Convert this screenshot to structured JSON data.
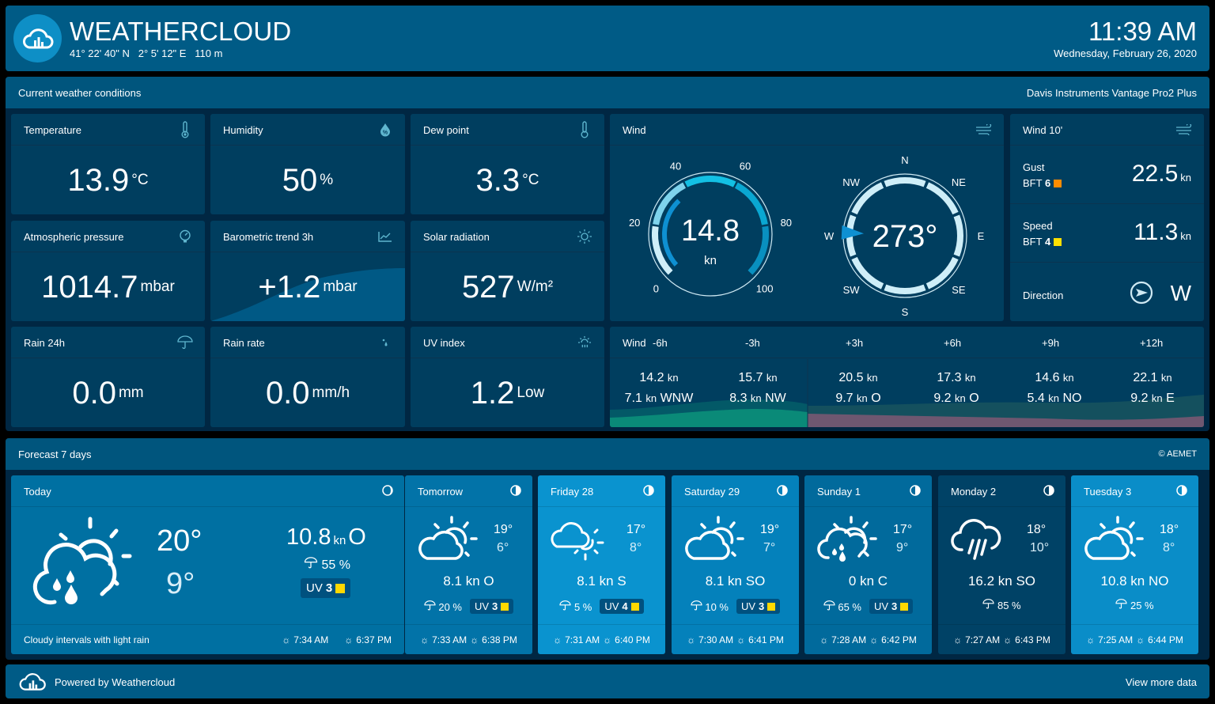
{
  "header": {
    "brand": "WEATHERCLOUD",
    "coords": "41° 22' 40\" N   2° 5' 12\" E   110 m",
    "time": "11:39 AM",
    "date": "Wednesday, February 26, 2020"
  },
  "current": {
    "title": "Current weather conditions",
    "device": "Davis Instruments Vantage Pro2 Plus",
    "temperature": {
      "label": "Temperature",
      "value": "13.9",
      "unit": "°C",
      "icon": "thermometer-icon"
    },
    "humidity": {
      "label": "Humidity",
      "value": "50",
      "unit": "%",
      "icon": "humidity-drop-icon"
    },
    "dewpoint": {
      "label": "Dew point",
      "value": "3.3",
      "unit": "°C",
      "icon": "thermometer-icon"
    },
    "pressure": {
      "label": "Atmospheric pressure",
      "value": "1014.7",
      "unit": "mbar",
      "icon": "barometer-icon"
    },
    "trend": {
      "label": "Barometric trend 3h",
      "value": "+1.2",
      "unit": "mbar",
      "icon": "trend-chart-icon"
    },
    "solar": {
      "label": "Solar radiation",
      "value": "527",
      "unit": "W/m²",
      "icon": "sun-icon"
    },
    "rain24": {
      "label": "Rain 24h",
      "value": "0.0",
      "unit": "mm",
      "icon": "umbrella-icon"
    },
    "rainrate": {
      "label": "Rain rate",
      "value": "0.0",
      "unit": "mm/h",
      "icon": "raindrops-icon"
    },
    "uv": {
      "label": "UV index",
      "value": "1.2",
      "unit": "Low",
      "icon": "uv-sun-icon"
    },
    "wind": {
      "label": "Wind",
      "speed": "14.8",
      "speed_value": 14.8,
      "speed_max": 100,
      "unit": "kn",
      "ticks": [
        "0",
        "20",
        "40",
        "60",
        "80",
        "100"
      ],
      "direction": "273°",
      "direction_deg": 273,
      "compass": [
        "N",
        "NE",
        "E",
        "SE",
        "S",
        "SW",
        "W",
        "NW"
      ]
    },
    "wind10": {
      "label": "Wind 10'",
      "gust_label": "Gust",
      "gust_bft": "BFT",
      "gust_bft_value": "6",
      "gust_color": "#ff8c00",
      "gust_value": "22.5",
      "speed_label": "Speed",
      "speed_bft": "BFT",
      "speed_bft_value": "4",
      "speed_color": "#ffe000",
      "speed_value": "11.3",
      "unit": "kn",
      "direction_label": "Direction",
      "direction_value": "W"
    },
    "wind_forecast": {
      "label": "Wind",
      "columns": [
        {
          "time": "-6h",
          "gust": "14.2",
          "mean": "7.1",
          "dir": "WNW"
        },
        {
          "time": "-3h",
          "gust": "15.7",
          "mean": "8.3",
          "dir": "NW"
        },
        {
          "time": "+3h",
          "gust": "20.5",
          "mean": "9.7",
          "dir": "O"
        },
        {
          "time": "+6h",
          "gust": "17.3",
          "mean": "9.2",
          "dir": "O"
        },
        {
          "time": "+9h",
          "gust": "14.6",
          "mean": "5.4",
          "dir": "NO"
        },
        {
          "time": "+12h",
          "gust": "22.1",
          "mean": "9.2",
          "dir": "E"
        }
      ],
      "unit": "kn"
    }
  },
  "forecast": {
    "title": "Forecast 7 days",
    "source": "© AEMET",
    "today": {
      "day": "Today",
      "hi": "20°",
      "lo": "9°",
      "wind": "10.8",
      "wind_unit": "kn",
      "wind_dir": "O",
      "rain": "55 %",
      "uv_label": "UV",
      "uv": "3",
      "description": "Cloudy intervals with light rain",
      "sunrise": "7:34 AM",
      "sunset": "6:37 PM"
    },
    "days": [
      {
        "day": "Tomorrow",
        "hi": "19°",
        "lo": "6°",
        "wind": "8.1 kn",
        "dir": "O",
        "rain": "20 %",
        "uv": "3",
        "sunrise": "7:33 AM",
        "sunset": "6:38 PM",
        "icon": "partly-cloudy-icon",
        "bg": "#0273a8"
      },
      {
        "day": "Friday 28",
        "hi": "17°",
        "lo": "8°",
        "wind": "8.1 kn",
        "dir": "S",
        "rain": "5 %",
        "uv": "4",
        "sunrise": "7:31 AM",
        "sunset": "6:40 PM",
        "icon": "cloud-sun-behind-icon",
        "bg": "#0a93cf"
      },
      {
        "day": "Saturday 29",
        "hi": "19°",
        "lo": "7°",
        "wind": "8.1 kn",
        "dir": "SO",
        "rain": "10 %",
        "uv": "3",
        "sunrise": "7:30 AM",
        "sunset": "6:41 PM",
        "icon": "partly-cloudy-icon",
        "bg": "#0481bb"
      },
      {
        "day": "Sunday 1",
        "hi": "17°",
        "lo": "9°",
        "wind": "0 kn",
        "dir": "C",
        "rain": "65 %",
        "uv": "3",
        "sunrise": "7:28 AM",
        "sunset": "6:42 PM",
        "icon": "cloud-sun-rain-icon",
        "bg": "#016a9c"
      },
      {
        "day": "Monday 2",
        "hi": "18°",
        "lo": "10°",
        "wind": "16.2 kn",
        "dir": "SO",
        "rain": "85 %",
        "uv": null,
        "sunrise": "7:27 AM",
        "sunset": "6:43 PM",
        "icon": "heavy-rain-icon",
        "bg": "#004266"
      },
      {
        "day": "Tuesday 3",
        "hi": "18°",
        "lo": "8°",
        "wind": "10.8 kn",
        "dir": "NO",
        "rain": "25 %",
        "uv": null,
        "sunrise": "7:25 AM",
        "sunset": "6:44 PM",
        "icon": "partly-cloudy-icon",
        "bg": "#0a8dc8"
      }
    ],
    "uv_label": "UV"
  },
  "footer": {
    "powered": "Powered by Weathercloud",
    "more": "View more data"
  }
}
